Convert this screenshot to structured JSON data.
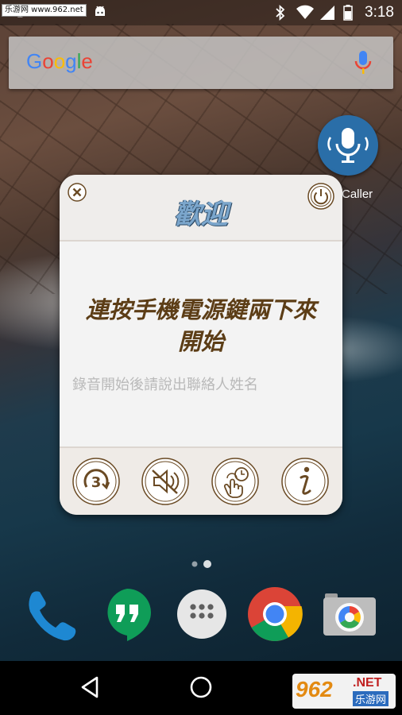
{
  "status_bar": {
    "watermark": "乐游网 www.962.net",
    "time": "3:18"
  },
  "search_bar": {
    "logo": "Google",
    "logo_colors": [
      "#4285F4",
      "#EA4335",
      "#FBBC05",
      "#4285F4",
      "#34A853",
      "#EA4335"
    ]
  },
  "background_app": {
    "label": "Caller"
  },
  "dialog": {
    "title": "歡迎",
    "main_text_line1": "連按手機電源鍵兩下來",
    "main_text_line2": "開始",
    "hint": "錄音開始後請說出聯絡人姓名",
    "footer_buttons": [
      "countdown-3-icon",
      "mute-speaker-icon",
      "tap-timer-icon",
      "info-icon"
    ]
  },
  "dock": {
    "icons": [
      "phone-icon",
      "hangouts-icon",
      "app-drawer-icon",
      "chrome-icon",
      "camera-icon"
    ]
  },
  "nav_bar": {
    "buttons": [
      "back-icon",
      "home-icon"
    ]
  },
  "corner_watermark": {
    "brand": "962",
    "suffix": ".NET",
    "chinese": "乐游网"
  },
  "colors": {
    "dialog_title": "#7ba6cc",
    "dialog_text": "#5c3d16",
    "hint_text": "#b9b9b9",
    "button_outline": "#6a4a24"
  }
}
